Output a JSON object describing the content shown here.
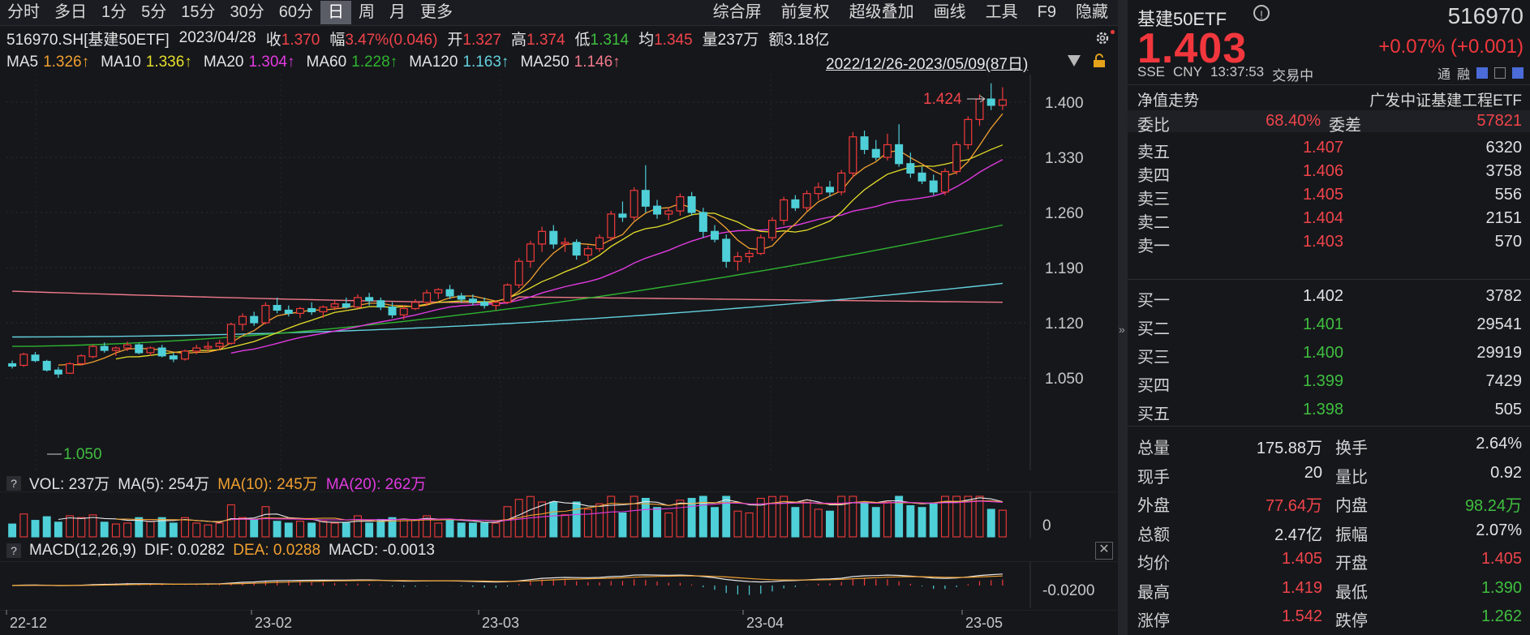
{
  "toolbar": {
    "items": [
      "分时",
      "多日",
      "1分",
      "5分",
      "15分",
      "30分",
      "60分",
      "日",
      "周",
      "月",
      "更多"
    ],
    "active_index": 7,
    "right_items": [
      "综合屏",
      "前复权",
      "超级叠加",
      "画线",
      "工具",
      "F9",
      "隐藏"
    ]
  },
  "quote_bar": {
    "symbol": "516970.SH[基建50ETF]",
    "date": "2023/04/28",
    "close_label": "收",
    "close": "1.370",
    "amp_label": "幅",
    "amp": "3.47%(0.046)",
    "open_label": "开",
    "open": "1.327",
    "high_label": "高",
    "high": "1.374",
    "low_label": "低",
    "low": "1.314",
    "avg_label": "均",
    "avg": "1.345",
    "vol_label": "量",
    "vol": "237万",
    "amt_label": "额",
    "amt": "3.18亿"
  },
  "ma_bar": {
    "items": [
      {
        "label": "MA5",
        "value": "1.326↑",
        "color": "#f0a030"
      },
      {
        "label": "MA10",
        "value": "1.336↑",
        "color": "#e6df2a"
      },
      {
        "label": "MA20",
        "value": "1.304↑",
        "color": "#e13ae0"
      },
      {
        "label": "MA60",
        "value": "1.228↑",
        "color": "#2fb42f"
      },
      {
        "label": "MA120",
        "value": "1.163↑",
        "color": "#63d1dd"
      },
      {
        "label": "MA250",
        "value": "1.146↑",
        "color": "#f07a8a"
      }
    ],
    "range": "2022/12/26-2023/05/09(87日)"
  },
  "price_axis": {
    "ticks": [
      "1.400",
      "1.330",
      "1.260",
      "1.190",
      "1.120",
      "1.050"
    ],
    "min": 1.05,
    "max": 1.4
  },
  "annotations": {
    "high": "1.424",
    "low": "1.050"
  },
  "volume_bar": {
    "vol": "VOL: 237万",
    "ma5": "MA(5): 254万",
    "ma10": "MA(10): 245万",
    "ma20": "MA(20): 262万",
    "axis_zero": "0"
  },
  "macd_bar": {
    "title": "MACD(12,26,9)",
    "dif": "DIF: 0.0282",
    "dea": "DEA: 0.0288",
    "macd": "MACD: -0.0013",
    "axis": "-0.0200"
  },
  "date_axis": [
    "22-12",
    "23-02",
    "23-03",
    "23-04",
    "23-05"
  ],
  "chart_data": {
    "type": "candlestick",
    "title": "516970.SH[基建50ETF]",
    "ylim": [
      1.05,
      1.4
    ],
    "candles": [
      [
        1.068,
        1.072,
        1.062,
        1.065
      ],
      [
        1.066,
        1.082,
        1.064,
        1.08
      ],
      [
        1.079,
        1.083,
        1.07,
        1.072
      ],
      [
        1.071,
        1.073,
        1.058,
        1.06
      ],
      [
        1.06,
        1.064,
        1.05,
        1.055
      ],
      [
        1.056,
        1.07,
        1.055,
        1.068
      ],
      [
        1.068,
        1.08,
        1.066,
        1.078
      ],
      [
        1.077,
        1.092,
        1.075,
        1.09
      ],
      [
        1.09,
        1.095,
        1.082,
        1.085
      ],
      [
        1.085,
        1.09,
        1.078,
        1.088
      ],
      [
        1.088,
        1.096,
        1.084,
        1.092
      ],
      [
        1.092,
        1.094,
        1.08,
        1.082
      ],
      [
        1.082,
        1.09,
        1.078,
        1.088
      ],
      [
        1.088,
        1.092,
        1.076,
        1.078
      ],
      [
        1.078,
        1.082,
        1.07,
        1.074
      ],
      [
        1.074,
        1.086,
        1.072,
        1.084
      ],
      [
        1.084,
        1.092,
        1.08,
        1.088
      ],
      [
        1.088,
        1.096,
        1.084,
        1.09
      ],
      [
        1.09,
        1.098,
        1.086,
        1.094
      ],
      [
        1.094,
        1.12,
        1.092,
        1.118
      ],
      [
        1.118,
        1.132,
        1.11,
        1.128
      ],
      [
        1.128,
        1.134,
        1.116,
        1.12
      ],
      [
        1.12,
        1.146,
        1.118,
        1.142
      ],
      [
        1.142,
        1.152,
        1.132,
        1.136
      ],
      [
        1.136,
        1.142,
        1.128,
        1.132
      ],
      [
        1.132,
        1.14,
        1.126,
        1.138
      ],
      [
        1.138,
        1.146,
        1.13,
        1.134
      ],
      [
        1.134,
        1.142,
        1.126,
        1.14
      ],
      [
        1.14,
        1.148,
        1.136,
        1.144
      ],
      [
        1.144,
        1.152,
        1.138,
        1.14
      ],
      [
        1.14,
        1.156,
        1.138,
        1.152
      ],
      [
        1.152,
        1.158,
        1.142,
        1.148
      ],
      [
        1.148,
        1.152,
        1.136,
        1.14
      ],
      [
        1.14,
        1.146,
        1.126,
        1.13
      ],
      [
        1.13,
        1.142,
        1.124,
        1.138
      ],
      [
        1.138,
        1.15,
        1.136,
        1.146
      ],
      [
        1.146,
        1.162,
        1.142,
        1.158
      ],
      [
        1.158,
        1.164,
        1.15,
        1.162
      ],
      [
        1.162,
        1.168,
        1.15,
        1.154
      ],
      [
        1.154,
        1.158,
        1.146,
        1.15
      ],
      [
        1.15,
        1.156,
        1.142,
        1.146
      ],
      [
        1.146,
        1.152,
        1.138,
        1.142
      ],
      [
        1.142,
        1.148,
        1.136,
        1.146
      ],
      [
        1.146,
        1.17,
        1.144,
        1.168
      ],
      [
        1.168,
        1.202,
        1.164,
        1.198
      ],
      [
        1.198,
        1.224,
        1.19,
        1.22
      ],
      [
        1.22,
        1.242,
        1.21,
        1.236
      ],
      [
        1.236,
        1.244,
        1.214,
        1.22
      ],
      [
        1.22,
        1.228,
        1.21,
        1.222
      ],
      [
        1.222,
        1.226,
        1.2,
        1.206
      ],
      [
        1.206,
        1.218,
        1.196,
        1.214
      ],
      [
        1.214,
        1.232,
        1.21,
        1.228
      ],
      [
        1.228,
        1.262,
        1.224,
        1.258
      ],
      [
        1.258,
        1.274,
        1.248,
        1.254
      ],
      [
        1.254,
        1.292,
        1.25,
        1.288
      ],
      [
        1.288,
        1.32,
        1.26,
        1.268
      ],
      [
        1.268,
        1.276,
        1.252,
        1.258
      ],
      [
        1.258,
        1.266,
        1.25,
        1.262
      ],
      [
        1.262,
        1.284,
        1.256,
        1.28
      ],
      [
        1.28,
        1.286,
        1.256,
        1.26
      ],
      [
        1.26,
        1.266,
        1.228,
        1.236
      ],
      [
        1.236,
        1.244,
        1.222,
        1.226
      ],
      [
        1.226,
        1.232,
        1.19,
        1.198
      ],
      [
        1.198,
        1.21,
        1.186,
        1.204
      ],
      [
        1.204,
        1.212,
        1.196,
        1.208
      ],
      [
        1.208,
        1.232,
        1.206,
        1.228
      ],
      [
        1.228,
        1.254,
        1.224,
        1.25
      ],
      [
        1.25,
        1.28,
        1.244,
        1.276
      ],
      [
        1.276,
        1.282,
        1.262,
        1.266
      ],
      [
        1.266,
        1.288,
        1.262,
        1.284
      ],
      [
        1.284,
        1.298,
        1.276,
        1.292
      ],
      [
        1.292,
        1.3,
        1.28,
        1.286
      ],
      [
        1.286,
        1.314,
        1.282,
        1.31
      ],
      [
        1.31,
        1.362,
        1.304,
        1.356
      ],
      [
        1.356,
        1.364,
        1.334,
        1.34
      ],
      [
        1.34,
        1.352,
        1.326,
        1.33
      ],
      [
        1.33,
        1.36,
        1.326,
        1.346
      ],
      [
        1.346,
        1.372,
        1.318,
        1.322
      ],
      [
        1.322,
        1.336,
        1.304,
        1.31
      ],
      [
        1.31,
        1.318,
        1.296,
        1.3
      ],
      [
        1.3,
        1.308,
        1.282,
        1.286
      ],
      [
        1.286,
        1.316,
        1.282,
        1.312
      ],
      [
        1.312,
        1.35,
        1.308,
        1.346
      ],
      [
        1.346,
        1.382,
        1.34,
        1.378
      ],
      [
        1.378,
        1.41,
        1.37,
        1.404
      ],
      [
        1.404,
        1.424,
        1.39,
        1.396
      ],
      [
        1.396,
        1.419,
        1.39,
        1.403
      ]
    ]
  },
  "side": {
    "name": "基建50ETF",
    "code": "516970",
    "price": "1.403",
    "change": "+0.07% (+0.001)",
    "exchange": "SSE",
    "currency": "CNY",
    "time": "13:37:53",
    "status": "交易中",
    "flag_tong": "通",
    "flag_rong": "融",
    "nav_label": "净值走势",
    "fund_name": "广发中证基建工程ETF",
    "wb_label": "委比",
    "wb_value": "68.40%",
    "wc_label": "委差",
    "wc_value": "57821",
    "asks": [
      {
        "label": "卖五",
        "price": "1.407",
        "vol": "6320"
      },
      {
        "label": "卖四",
        "price": "1.406",
        "vol": "3758"
      },
      {
        "label": "卖三",
        "price": "1.405",
        "vol": "556"
      },
      {
        "label": "卖二",
        "price": "1.404",
        "vol": "2151"
      },
      {
        "label": "卖一",
        "price": "1.403",
        "vol": "570"
      }
    ],
    "bids": [
      {
        "label": "买一",
        "price": "1.402",
        "vol": "3782",
        "color": "#e3e3e3"
      },
      {
        "label": "买二",
        "price": "1.401",
        "vol": "29541",
        "color": "#3fbf3f"
      },
      {
        "label": "买三",
        "price": "1.400",
        "vol": "29919",
        "color": "#3fbf3f"
      },
      {
        "label": "买四",
        "price": "1.399",
        "vol": "7429",
        "color": "#3fbf3f"
      },
      {
        "label": "买五",
        "price": "1.398",
        "vol": "505",
        "color": "#3fbf3f"
      }
    ],
    "stats": [
      {
        "l1": "总量",
        "v1": "175.88万",
        "c1": "#e3e3e3",
        "l2": "换手",
        "v2": "2.64%",
        "c2": "#e3e3e3"
      },
      {
        "l1": "现手",
        "v1": "20",
        "c1": "#e3e3e3",
        "l2": "量比",
        "v2": "0.92",
        "c2": "#e3e3e3"
      },
      {
        "l1": "外盘",
        "v1": "77.64万",
        "c1": "#f0444a",
        "l2": "内盘",
        "v2": "98.24万",
        "c2": "#3fbf3f"
      },
      {
        "l1": "总额",
        "v1": "2.47亿",
        "c1": "#e3e3e3",
        "l2": "振幅",
        "v2": "2.07%",
        "c2": "#e3e3e3"
      },
      {
        "l1": "均价",
        "v1": "1.405",
        "c1": "#f0444a",
        "l2": "开盘",
        "v2": "1.405",
        "c2": "#f0444a"
      },
      {
        "l1": "最高",
        "v1": "1.419",
        "c1": "#f0444a",
        "l2": "最低",
        "v2": "1.390",
        "c2": "#3fbf3f"
      },
      {
        "l1": "涨停",
        "v1": "1.542",
        "c1": "#f0444a",
        "l2": "跌停",
        "v2": "1.262",
        "c2": "#3fbf3f"
      }
    ]
  }
}
